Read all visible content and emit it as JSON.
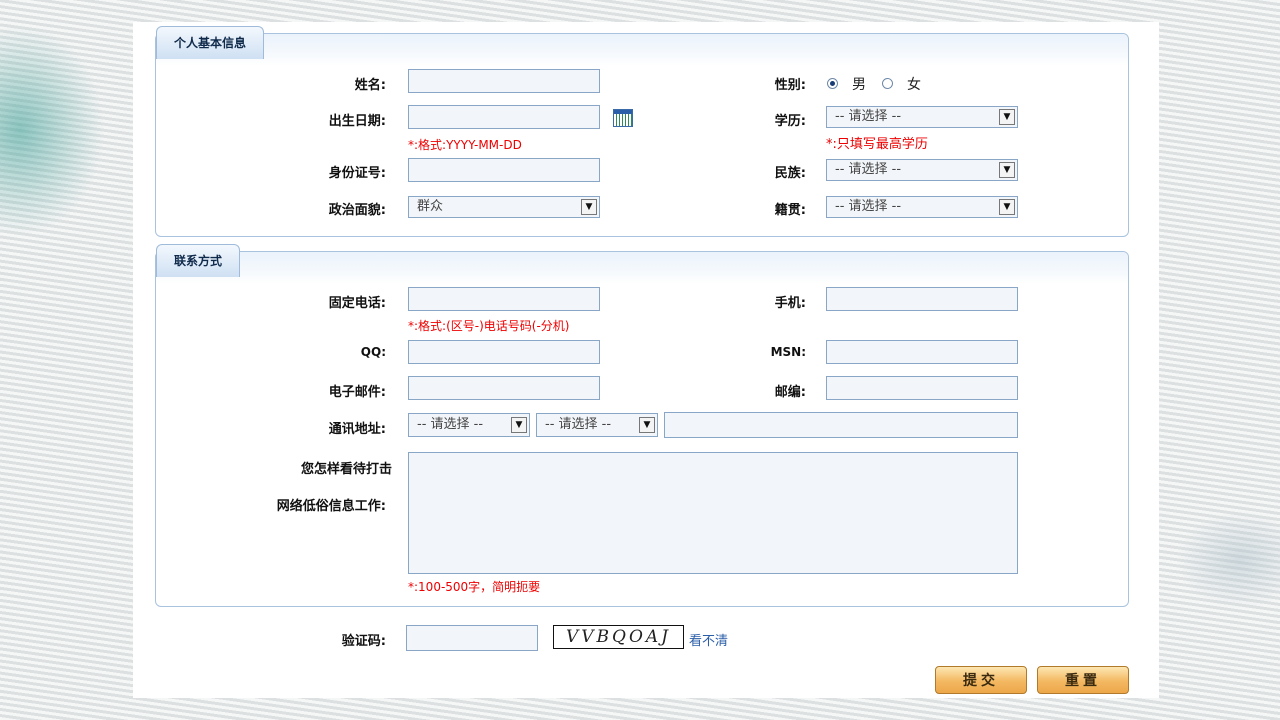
{
  "personal": {
    "tab": "个人基本信息",
    "name_label": "姓名:",
    "gender_label": "性别:",
    "gender_male": "男",
    "gender_female": "女",
    "gender_selected": "男",
    "birth_label": "出生日期:",
    "birth_hint": "*:格式:YYYY-MM-DD",
    "education_label": "学历:",
    "education_value": "-- 请选择 --",
    "education_hint": "*:只填写最高学历",
    "id_label": "身份证号:",
    "ethnicity_label": "民族:",
    "ethnicity_value": "-- 请选择 --",
    "politics_label": "政治面貌:",
    "politics_value": "群众",
    "hometown_label": "籍贯:",
    "hometown_value": "-- 请选择 --"
  },
  "contact": {
    "tab": "联系方式",
    "phone_label": "固定电话:",
    "phone_hint": "*:格式:(区号-)电话号码(-分机)",
    "mobile_label": "手机:",
    "qq_label": "QQ:",
    "msn_label": "MSN:",
    "email_label": "电子邮件:",
    "zip_label": "邮编:",
    "address_label": "通讯地址:",
    "address_province": "-- 请选择 --",
    "address_city": "-- 请选择 --",
    "opinion_label_1": "您怎样看待打击",
    "opinion_label_2": "网络低俗信息工作:",
    "opinion_hint": "*:100-500字，简明扼要"
  },
  "captcha": {
    "label": "验证码:",
    "image_text": "VVBQOAJ",
    "refresh_link": "看不清"
  },
  "buttons": {
    "submit": "提交",
    "reset": "重置"
  }
}
